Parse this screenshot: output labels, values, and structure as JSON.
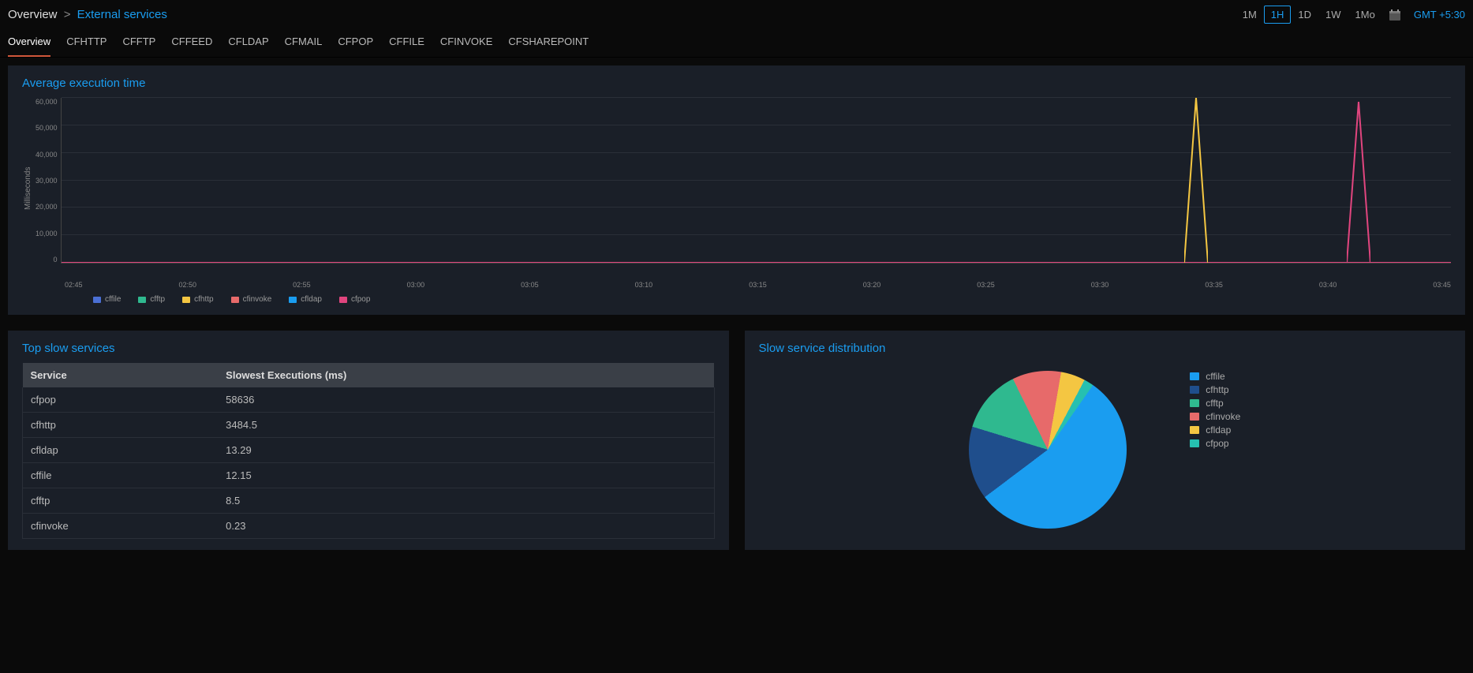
{
  "breadcrumb": {
    "root": "Overview",
    "sep": ">",
    "leaf": "External services"
  },
  "time_ranges": [
    "1M",
    "1H",
    "1D",
    "1W",
    "1Mo"
  ],
  "time_active": "1H",
  "gmt": "GMT +5:30",
  "tabs": [
    "Overview",
    "CFHTTP",
    "CFFTP",
    "CFFEED",
    "CFLDAP",
    "CFMAIL",
    "CFPOP",
    "CFFILE",
    "CFINVOKE",
    "CFSHAREPOINT"
  ],
  "tab_active": "Overview",
  "line_chart_title": "Average execution time",
  "table_title": "Top slow services",
  "table_headers": [
    "Service",
    "Slowest Executions (ms)"
  ],
  "table_rows": [
    {
      "service": "cfpop",
      "value": "58636"
    },
    {
      "service": "cfhttp",
      "value": "3484.5"
    },
    {
      "service": "cfldap",
      "value": "13.29"
    },
    {
      "service": "cffile",
      "value": "12.15"
    },
    {
      "service": "cfftp",
      "value": "8.5"
    },
    {
      "service": "cfinvoke",
      "value": "0.23"
    }
  ],
  "pie_title": "Slow service distribution",
  "colors": {
    "cffile": "#1a9df0",
    "cfhttp": "#1f4e8c",
    "cfftp": "#2fb98f",
    "cfinvoke": "#e76a6a",
    "cfldap": "#f4c642",
    "cfpop": "#26c0b0"
  },
  "chart_data": {
    "line": {
      "type": "line",
      "title": "Average execution time",
      "ylabel": "Milliseconds",
      "xlabel": "",
      "ylim": [
        0,
        60000
      ],
      "y_ticks": [
        60000,
        50000,
        40000,
        30000,
        20000,
        10000,
        0
      ],
      "y_tick_labels": [
        "60,000",
        "50,000",
        "40,000",
        "30,000",
        "20,000",
        "10,000",
        "0"
      ],
      "x_tick_labels": [
        "02:45",
        "02:50",
        "02:55",
        "03:00",
        "03:05",
        "03:10",
        "03:15",
        "03:20",
        "03:25",
        "03:30",
        "03:35",
        "03:40",
        "03:45"
      ],
      "x": [
        "02:45",
        "02:46",
        "02:47",
        "02:48",
        "02:49",
        "02:50",
        "02:51",
        "02:52",
        "02:53",
        "02:54",
        "02:55",
        "02:56",
        "02:57",
        "02:58",
        "02:59",
        "03:00",
        "03:01",
        "03:02",
        "03:03",
        "03:04",
        "03:05",
        "03:06",
        "03:07",
        "03:08",
        "03:09",
        "03:10",
        "03:11",
        "03:12",
        "03:13",
        "03:14",
        "03:15",
        "03:16",
        "03:17",
        "03:18",
        "03:19",
        "03:20",
        "03:21",
        "03:22",
        "03:23",
        "03:24",
        "03:25",
        "03:26",
        "03:27",
        "03:28",
        "03:29",
        "03:30",
        "03:31",
        "03:32",
        "03:33",
        "03:34",
        "03:35",
        "03:36",
        "03:37",
        "03:38",
        "03:39",
        "03:40",
        "03:41",
        "03:42",
        "03:43",
        "03:44",
        "03:45"
      ],
      "series": [
        {
          "name": "cffile",
          "color": "#1a9df0",
          "values": [
            0,
            0,
            0,
            0,
            0,
            0,
            0,
            0,
            0,
            0,
            0,
            0,
            0,
            0,
            0,
            0,
            0,
            0,
            0,
            0,
            0,
            0,
            0,
            0,
            0,
            0,
            0,
            0,
            0,
            0,
            0,
            0,
            0,
            0,
            0,
            0,
            0,
            0,
            0,
            0,
            0,
            0,
            0,
            0,
            0,
            0,
            0,
            0,
            0,
            0,
            0,
            0,
            0,
            0,
            0,
            0,
            0,
            0,
            0,
            0,
            0
          ]
        },
        {
          "name": "cfftp",
          "color": "#2fb98f",
          "values": [
            0,
            0,
            0,
            0,
            0,
            0,
            0,
            0,
            0,
            0,
            0,
            0,
            0,
            0,
            0,
            0,
            0,
            0,
            0,
            0,
            0,
            0,
            0,
            0,
            0,
            0,
            0,
            0,
            0,
            0,
            0,
            0,
            0,
            0,
            0,
            0,
            0,
            0,
            0,
            0,
            0,
            0,
            0,
            0,
            0,
            0,
            0,
            0,
            0,
            0,
            0,
            0,
            0,
            0,
            0,
            0,
            0,
            0,
            0,
            0,
            0
          ]
        },
        {
          "name": "cfhttp",
          "color": "#f4c642",
          "values": [
            0,
            0,
            0,
            0,
            0,
            0,
            0,
            0,
            0,
            0,
            0,
            0,
            0,
            0,
            0,
            0,
            0,
            0,
            0,
            0,
            0,
            0,
            0,
            0,
            0,
            0,
            0,
            0,
            0,
            0,
            0,
            0,
            0,
            0,
            0,
            0,
            0,
            0,
            0,
            0,
            0,
            0,
            0,
            0,
            0,
            0,
            0,
            0,
            0,
            60000,
            0,
            0,
            0,
            0,
            0,
            0,
            0,
            0,
            0,
            0,
            0
          ]
        },
        {
          "name": "cfinvoke",
          "color": "#e76a6a",
          "values": [
            0,
            0,
            0,
            0,
            0,
            0,
            0,
            0,
            0,
            0,
            0,
            0,
            0,
            0,
            0,
            0,
            0,
            0,
            0,
            0,
            0,
            0,
            0,
            0,
            0,
            0,
            0,
            0,
            0,
            0,
            0,
            0,
            0,
            0,
            0,
            0,
            0,
            0,
            0,
            0,
            0,
            0,
            0,
            0,
            0,
            0,
            0,
            0,
            0,
            0,
            0,
            0,
            0,
            0,
            0,
            0,
            0,
            0,
            0,
            0,
            0
          ]
        },
        {
          "name": "cfldap",
          "color": "#1a9df0",
          "values": [
            0,
            0,
            0,
            0,
            0,
            0,
            0,
            0,
            0,
            0,
            0,
            0,
            0,
            0,
            0,
            0,
            0,
            0,
            0,
            0,
            0,
            0,
            0,
            0,
            0,
            0,
            0,
            0,
            0,
            0,
            0,
            0,
            0,
            0,
            0,
            0,
            0,
            0,
            0,
            0,
            0,
            0,
            0,
            0,
            0,
            0,
            0,
            0,
            0,
            0,
            0,
            0,
            0,
            0,
            0,
            0,
            0,
            0,
            0,
            0,
            0
          ]
        },
        {
          "name": "cfpop",
          "color": "#e0457e",
          "values": [
            0,
            0,
            0,
            0,
            0,
            0,
            0,
            0,
            0,
            0,
            0,
            0,
            0,
            0,
            0,
            0,
            0,
            0,
            0,
            0,
            0,
            0,
            0,
            0,
            0,
            0,
            0,
            0,
            0,
            0,
            0,
            0,
            0,
            0,
            0,
            0,
            0,
            0,
            0,
            0,
            0,
            0,
            0,
            0,
            0,
            0,
            0,
            0,
            0,
            0,
            0,
            0,
            0,
            0,
            0,
            0,
            58636,
            0,
            0,
            0,
            0
          ]
        }
      ],
      "legend": [
        "cffile",
        "cfftp",
        "cfhttp",
        "cfinvoke",
        "cfldap",
        "cfpop"
      ],
      "legend_colors": [
        "#4a6fd4",
        "#2fb98f",
        "#f4c642",
        "#e76a6a",
        "#1a9df0",
        "#e0457e"
      ]
    },
    "pie": {
      "type": "pie",
      "title": "Slow service distribution",
      "slices": [
        {
          "name": "cffile",
          "value": 55,
          "color": "#1a9df0"
        },
        {
          "name": "cfhttp",
          "value": 15,
          "color": "#1f4e8c"
        },
        {
          "name": "cfftp",
          "value": 13,
          "color": "#2fb98f"
        },
        {
          "name": "cfinvoke",
          "value": 10,
          "color": "#e76a6a"
        },
        {
          "name": "cfldap",
          "value": 5,
          "color": "#f4c642"
        },
        {
          "name": "cfpop",
          "value": 2,
          "color": "#26c0b0"
        }
      ]
    }
  }
}
